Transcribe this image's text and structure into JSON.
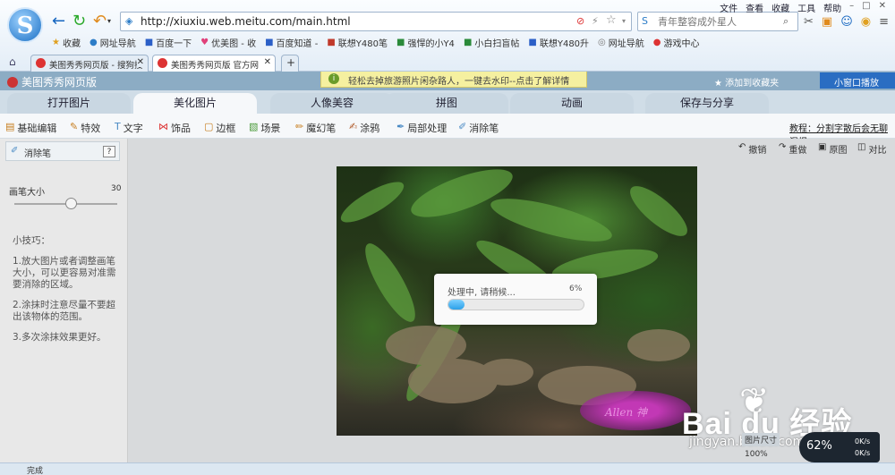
{
  "browser": {
    "menu": [
      "文件",
      "查看",
      "收藏",
      "工具",
      "帮助"
    ],
    "url": "http://xiuxiu.web.meitu.com/main.html",
    "search_placeholder": "青年整容成外星人",
    "bookmarks": [
      "收藏",
      "网址导航",
      "百度一下",
      "优美图 - 收",
      "百度知道 -",
      "联想Y480笔",
      "强悍的小Y4",
      "小白扫盲帖",
      "联想Y480升",
      "网址导航",
      "游戏中心"
    ],
    "tabs": [
      "美图秀秀网页版 - 搜狗搜",
      "美图秀秀网页版 官方网"
    ],
    "status": "完成",
    "colors": {
      "chrome_top": "#fbfdff",
      "tab_active": "#ffffff"
    }
  },
  "app": {
    "title": "美图秀秀网页版",
    "notice": "轻松去掉旅游照片闲杂路人，一键去水印--点击了解详情",
    "add_fav": "添加到收藏夹",
    "small_window": "小窗口播放",
    "main_tabs": [
      "打开图片",
      "美化图片",
      "人像美容",
      "拼图",
      "动画",
      "保存与分享"
    ],
    "tools": [
      "基础编辑",
      "特效",
      "文字",
      "饰品",
      "边框",
      "场景",
      "魔幻笔",
      "涂鸦",
      "局部处理",
      "消除笔"
    ],
    "tutorial": "教程：分割字散后会无聊混报",
    "panel": {
      "header": "消除笔",
      "help": "?",
      "brush_label": "画笔大小",
      "brush_value": "30",
      "brush_level": 0.55,
      "tips_title": "小技巧：",
      "tips": [
        "1.放大图片或者调整画笔大小，可以更容易对准需要消除的区域。",
        "2.涂抹时注意尽量不要超出该物体的范围。",
        "3.多次涂抹效果更好。"
      ]
    },
    "actions": [
      "撤销",
      "重做",
      "原图",
      "对比"
    ],
    "progress": {
      "text": "处理中, 请稍候...",
      "percent_label": "6%",
      "value": 0.06
    },
    "watermark": "Allen 神"
  },
  "overlay": {
    "baidu": "Bai du 经验",
    "baidu_url": "jingyan.baidu.com",
    "image_size": "图片尺寸",
    "zoom": "100%",
    "speed_percent": "62%",
    "speed_up": "0K/s",
    "speed_down": "0K/s"
  }
}
